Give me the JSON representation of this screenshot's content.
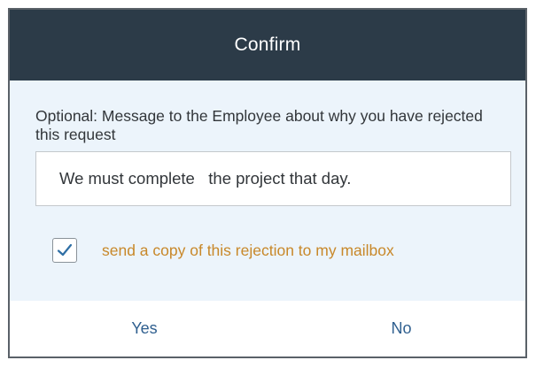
{
  "dialog": {
    "title": "Confirm",
    "prompt": "Optional: Message to the Employee about why you have rejected this request",
    "message_value": "We must complete   the project that day.",
    "copy_checkbox": {
      "checked": true,
      "label": "send a copy of this rejection to my mailbox"
    },
    "buttons": {
      "yes_label": "Yes",
      "no_label": "No"
    }
  },
  "colors": {
    "header_bg": "#2c3b48",
    "body_bg": "#ecf4fb",
    "checkbox_label": "#c8882a",
    "button_text": "#2f5f8f"
  }
}
